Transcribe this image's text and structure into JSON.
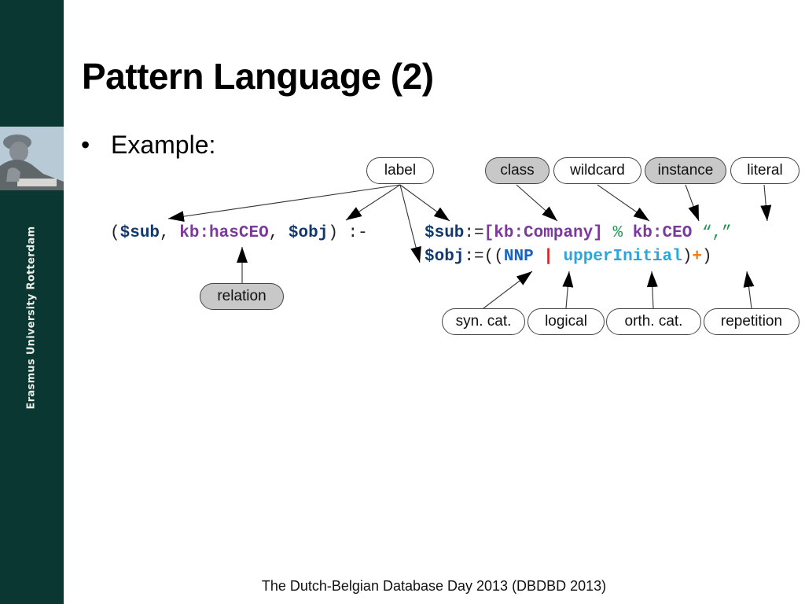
{
  "sidebar": {
    "institution": "Erasmus University Rotterdam",
    "image": "erasmus-statue-photo",
    "color": "#0b3733"
  },
  "slide": {
    "title": "Pattern Language (2)",
    "bullet": {
      "marker": "•",
      "text": "Example:"
    }
  },
  "pattern": {
    "head": {
      "open": "(",
      "sub": "$sub",
      "comma1": ", ",
      "relation": "kb:hasCEO",
      "comma2": ", ",
      "obj": "$obj",
      "close": ")",
      "implies": " :-"
    },
    "line1": {
      "var": "$sub",
      "assign": ":=",
      "class": "[kb:Company]",
      "wildcard": "%",
      "instance": "kb:CEO",
      "literal": "“,”"
    },
    "line2": {
      "var": "$obj",
      "assign": ":=",
      "open": "((",
      "syncat": "NNP",
      "logical": "|",
      "orthcat": "upperInitial",
      "close1": ")",
      "repetition": "+",
      "close2": ")"
    }
  },
  "annotations": {
    "top": [
      {
        "label": "label",
        "style": "white"
      },
      {
        "label": "class",
        "style": "grey"
      },
      {
        "label": "wildcard",
        "style": "white"
      },
      {
        "label": "instance",
        "style": "grey"
      },
      {
        "label": "literal",
        "style": "white"
      }
    ],
    "left": [
      {
        "label": "relation",
        "style": "grey"
      }
    ],
    "bottom": [
      {
        "label": "syn. cat.",
        "style": "white"
      },
      {
        "label": "logical",
        "style": "white"
      },
      {
        "label": "orth. cat.",
        "style": "white"
      },
      {
        "label": "repetition",
        "style": "white"
      }
    ]
  },
  "colors": {
    "variable": "#13386b",
    "relation": "#7b3a9b",
    "wildcard": "#1e9a50",
    "syntactic_category": "#1565c0",
    "logical": "#e02020",
    "orthographic_category": "#2aa6dc",
    "repetition": "#f07d15",
    "grey_pill": "#c8c8c8"
  },
  "footer": {
    "text": "The Dutch-Belgian Database Day 2013 (DBDBD 2013)"
  }
}
